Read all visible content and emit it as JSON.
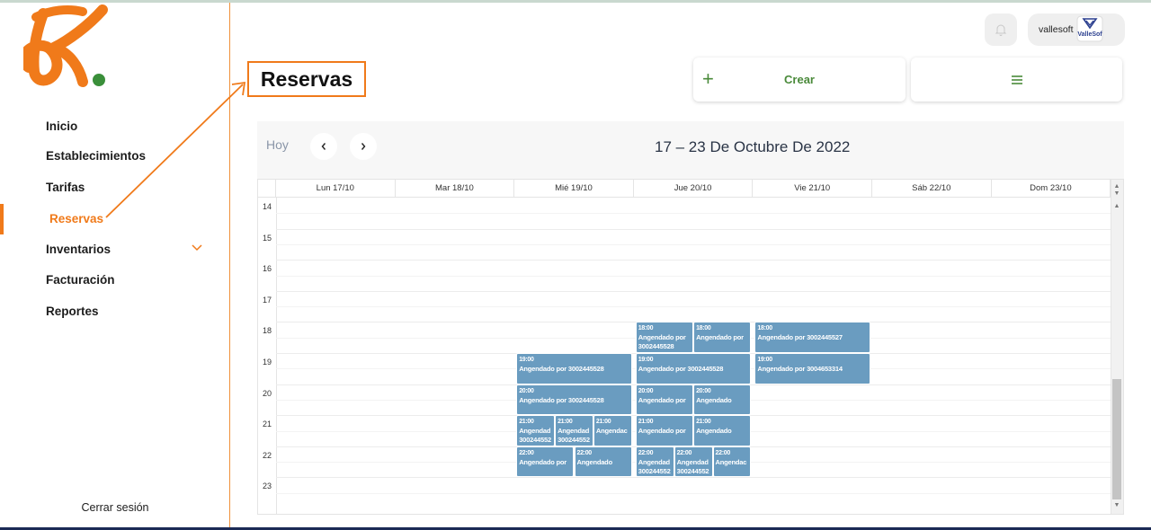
{
  "sidebar": {
    "menu": [
      {
        "label": "Inicio"
      },
      {
        "label": "Establecimientos"
      },
      {
        "label": "Tarifas"
      },
      {
        "label": "Reservas",
        "active": true
      },
      {
        "label": "Inventarios",
        "has_submenu": true
      },
      {
        "label": "Facturación"
      },
      {
        "label": "Reportes"
      }
    ],
    "logout_label": "Cerrar sesión"
  },
  "header": {
    "user_name": "vallesoft",
    "avatar_text": "ValleSof",
    "bell_icon": "bell-icon"
  },
  "page": {
    "title": "Reservas"
  },
  "actions": {
    "create_label": "Crear",
    "create_icon": "plus-icon",
    "menu_icon": "hamburger-icon"
  },
  "calendar": {
    "today_label": "Hoy",
    "range_title": "17 – 23 De Octubre De 2022",
    "days": [
      "Lun 17/10",
      "Mar 18/10",
      "Mié 19/10",
      "Jue 20/10",
      "Vie 21/10",
      "Sáb 22/10",
      "Dom 23/10"
    ],
    "hours": [
      "14",
      "15",
      "16",
      "17",
      "18",
      "19",
      "20",
      "21",
      "22",
      "23"
    ],
    "events": [
      {
        "day": 3,
        "hour": 18,
        "col": 0,
        "cols": 2,
        "time": "18:00",
        "text": "Angendado por 3002445528"
      },
      {
        "day": 3,
        "hour": 18,
        "col": 1,
        "cols": 2,
        "time": "18:00",
        "text": "Angendado por"
      },
      {
        "day": 4,
        "hour": 18,
        "col": 0,
        "cols": 1,
        "time": "18:00",
        "text": "Angendado por 3002445527"
      },
      {
        "day": 2,
        "hour": 19,
        "col": 0,
        "cols": 1,
        "time": "19:00",
        "text": "Angendado por 3002445528"
      },
      {
        "day": 3,
        "hour": 19,
        "col": 0,
        "cols": 1,
        "time": "19:00",
        "text": "Angendado por 3002445528"
      },
      {
        "day": 4,
        "hour": 19,
        "col": 0,
        "cols": 1,
        "time": "19:00",
        "text": "Angendado por 3004653314"
      },
      {
        "day": 2,
        "hour": 20,
        "col": 0,
        "cols": 1,
        "time": "20:00",
        "text": "Angendado por 3002445528"
      },
      {
        "day": 3,
        "hour": 20,
        "col": 0,
        "cols": 2,
        "time": "20:00",
        "text": "Angendado por"
      },
      {
        "day": 3,
        "hour": 20,
        "col": 1,
        "cols": 2,
        "time": "20:00",
        "text": "Angendado"
      },
      {
        "day": 2,
        "hour": 21,
        "col": 0,
        "cols": 3,
        "time": "21:00",
        "text": "Angendad 300244552"
      },
      {
        "day": 2,
        "hour": 21,
        "col": 1,
        "cols": 3,
        "time": "21:00",
        "text": "Angendad 300244552"
      },
      {
        "day": 2,
        "hour": 21,
        "col": 2,
        "cols": 3,
        "time": "21:00",
        "text": "Angendac"
      },
      {
        "day": 3,
        "hour": 21,
        "col": 0,
        "cols": 2,
        "time": "21:00",
        "text": "Angendado por"
      },
      {
        "day": 3,
        "hour": 21,
        "col": 1,
        "cols": 2,
        "time": "21:00",
        "text": "Angendado"
      },
      {
        "day": 2,
        "hour": 22,
        "col": 0,
        "cols": 2,
        "time": "22:00",
        "text": "Angendado por"
      },
      {
        "day": 2,
        "hour": 22,
        "col": 1,
        "cols": 2,
        "time": "22:00",
        "text": "Angendado"
      },
      {
        "day": 3,
        "hour": 22,
        "col": 0,
        "cols": 3,
        "time": "22:00",
        "text": "Angendad 300244552"
      },
      {
        "day": 3,
        "hour": 22,
        "col": 1,
        "cols": 3,
        "time": "22:00",
        "text": "Angendad 300244552"
      },
      {
        "day": 3,
        "hour": 22,
        "col": 2,
        "cols": 3,
        "time": "22:00",
        "text": "Angendac"
      }
    ]
  },
  "colors": {
    "brand_orange": "#f07a1a",
    "brand_green": "#4a8a3a",
    "event_blue": "#6a9cc0",
    "logo_green": "#3a8f3a"
  }
}
